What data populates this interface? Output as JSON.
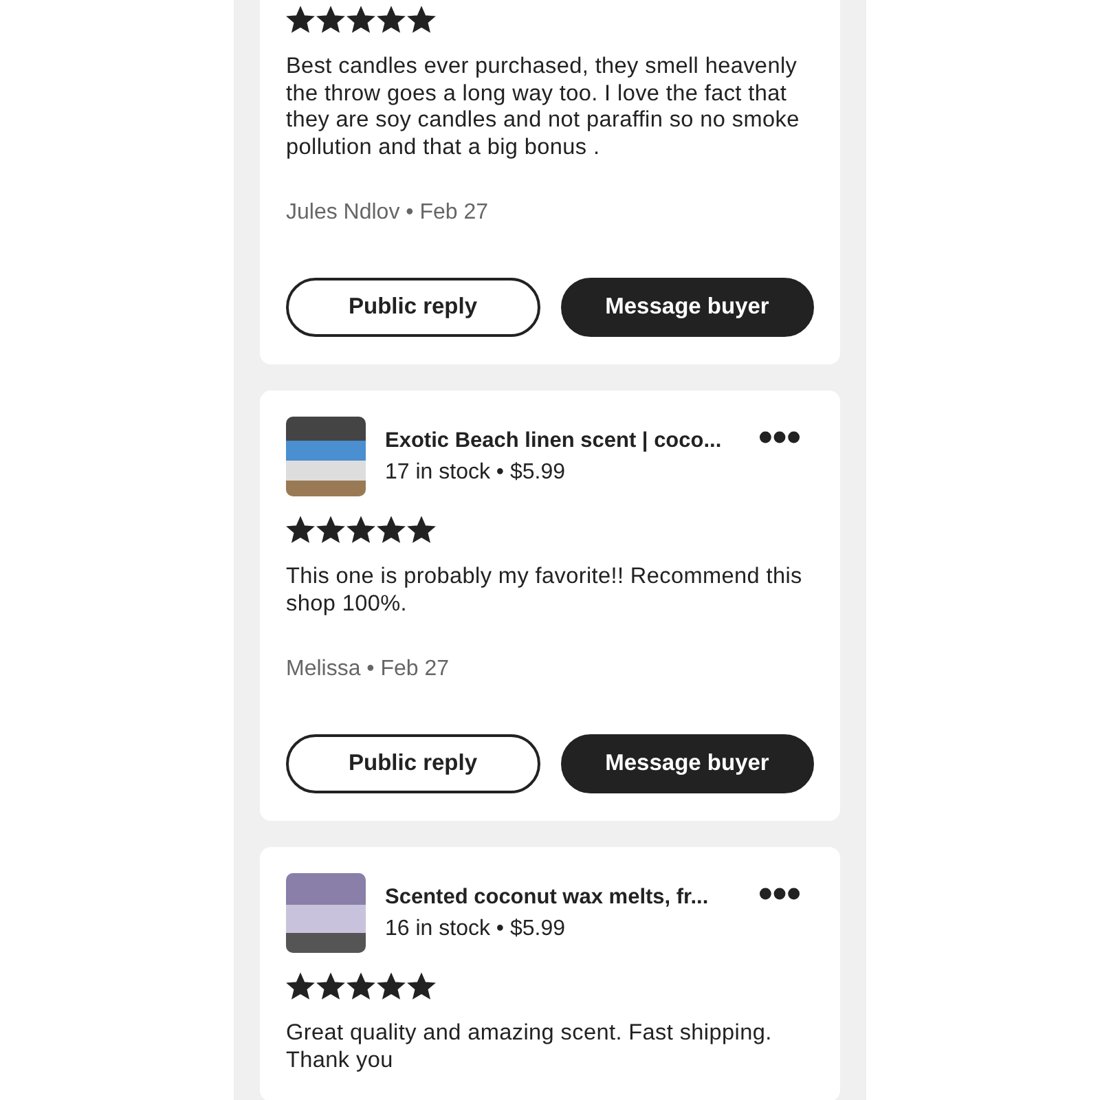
{
  "reviews": [
    {
      "stars": 5,
      "text": "Best candles ever purchased, they smell heavenly the throw goes a long way too. I love the fact that they are soy candles and not paraffin so no smoke pollution and that a big bonus .",
      "author": "Jules Ndlov • Feb 27",
      "buttons": [
        "Public reply",
        "Message buyer"
      ]
    },
    {
      "product": {
        "title": "Exotic Beach linen scent | coco...",
        "stock": "17 in stock • $5.99"
      },
      "stars": 5,
      "text": "This one is probably my favorite!! Recommend this shop 100%.",
      "author": "Melissa • Feb 27",
      "buttons": [
        "Public reply",
        "Message buyer"
      ]
    },
    {
      "product": {
        "title": "Scented coconut wax melts, fr...",
        "stock": "16 in stock • $5.99"
      },
      "stars": 5,
      "text": "Great quality and amazing scent. Fast shipping. Thank you"
    }
  ]
}
